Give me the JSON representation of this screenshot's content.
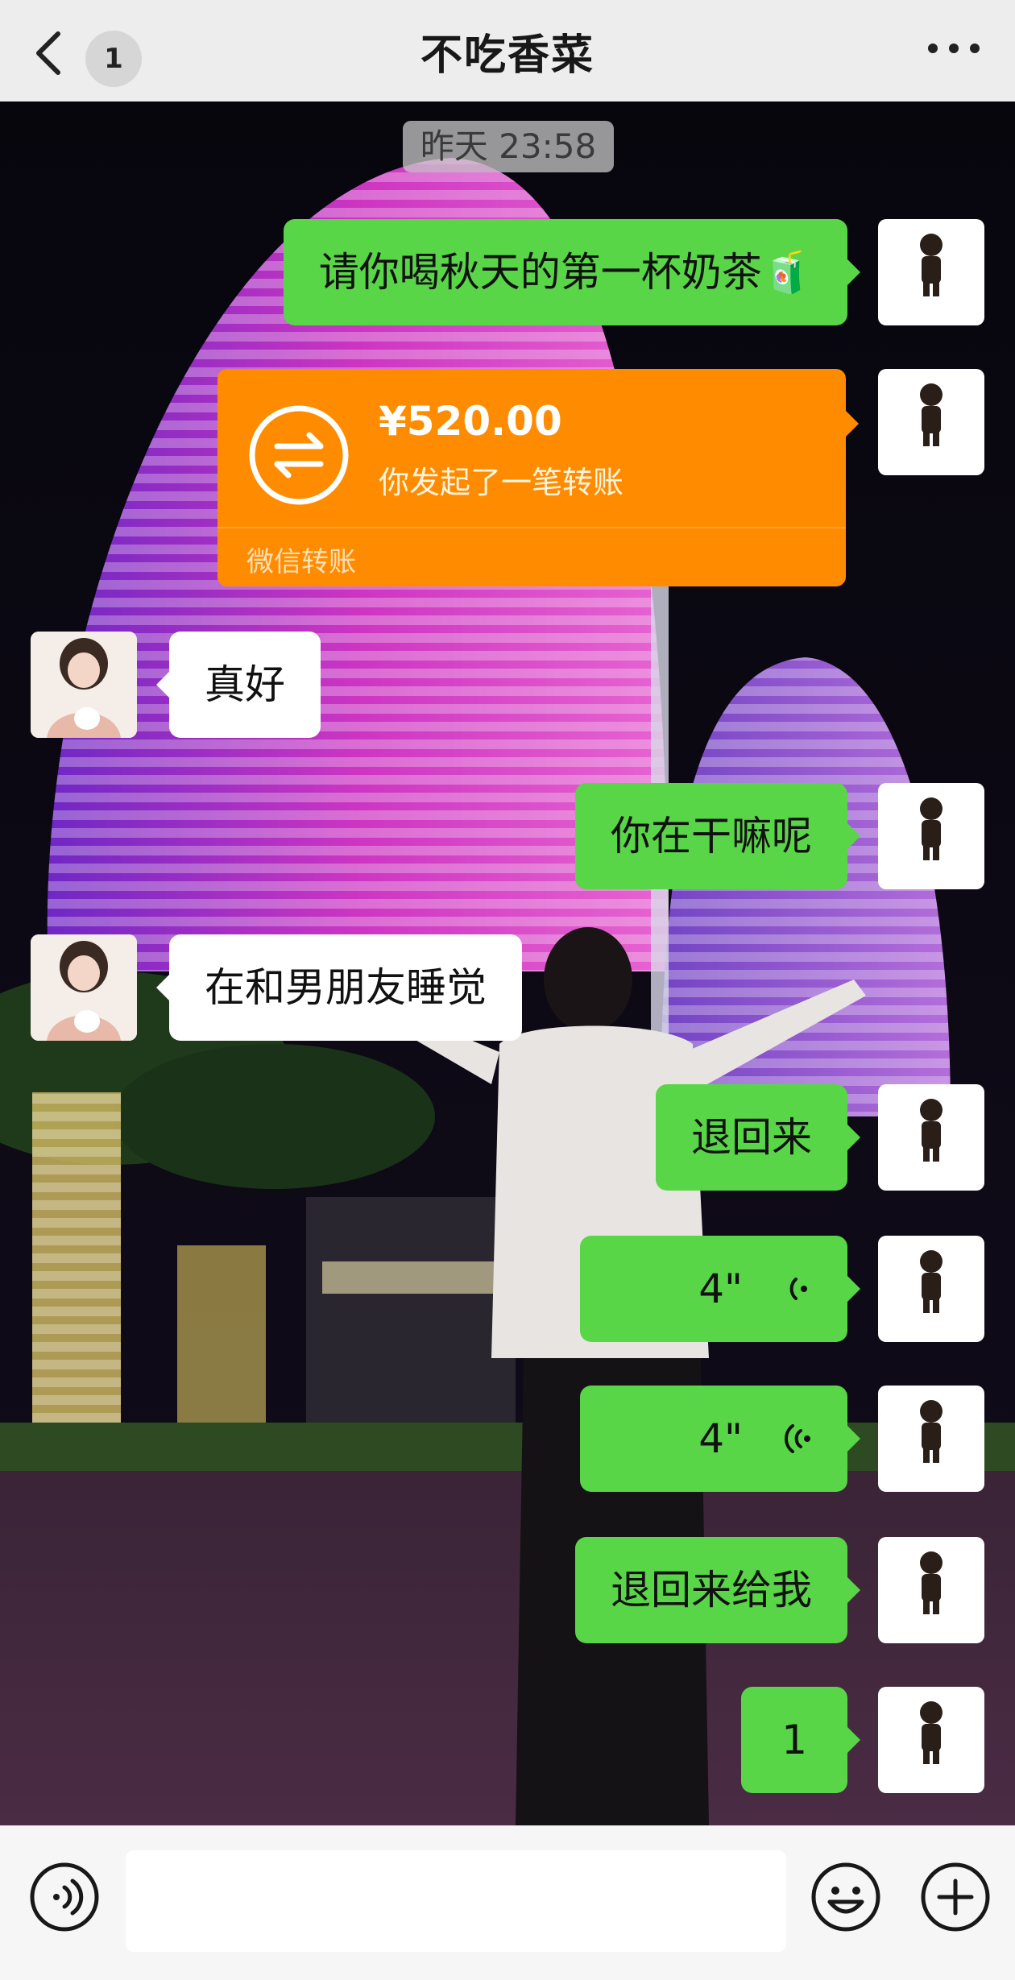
{
  "header": {
    "title": "不吃香菜",
    "unread_count": "1",
    "back_icon": "chevron-left-icon",
    "more_icon": "ellipsis-icon"
  },
  "timestamp": "昨天 23:58",
  "messages": [
    {
      "sender": "me",
      "type": "text",
      "text": "请你喝秋天的第一杯奶茶🧃"
    },
    {
      "sender": "me",
      "type": "transfer",
      "amount": "¥520.00",
      "desc": "你发起了一笔转账",
      "label": "微信转账"
    },
    {
      "sender": "other",
      "type": "text",
      "text": "真好"
    },
    {
      "sender": "me",
      "type": "text",
      "text": "你在干嘛呢"
    },
    {
      "sender": "other",
      "type": "text",
      "text": "在和男朋友睡觉"
    },
    {
      "sender": "me",
      "type": "text",
      "text": "退回来"
    },
    {
      "sender": "me",
      "type": "voice",
      "duration": "4\""
    },
    {
      "sender": "me",
      "type": "voice",
      "duration": "4\""
    },
    {
      "sender": "me",
      "type": "text",
      "text": "退回来给我"
    },
    {
      "sender": "me",
      "type": "text",
      "text": "1"
    }
  ],
  "input_bar": {
    "placeholder": "",
    "voice_icon": "voice-input-icon",
    "emoji_icon": "emoji-icon",
    "plus_icon": "plus-circle-icon"
  },
  "colors": {
    "bubble_self": "#59d548",
    "bubble_other": "#ffffff",
    "transfer": "#ff8c00",
    "header_bg": "#ededed"
  }
}
